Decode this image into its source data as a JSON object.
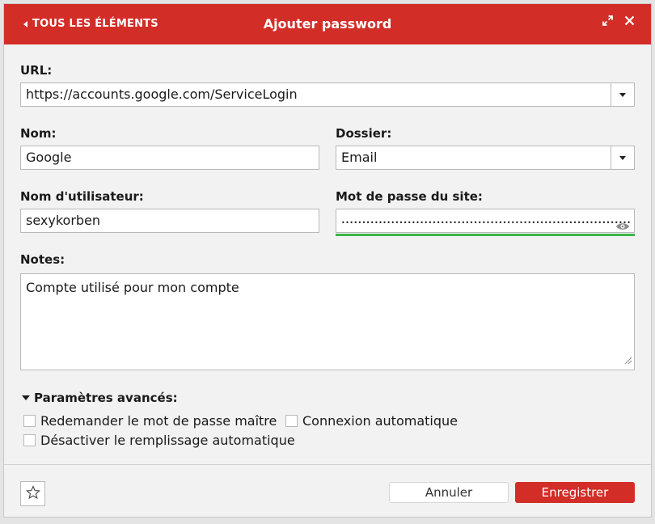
{
  "header": {
    "back_label": "TOUS LES ÉLÉMENTS",
    "title": "Ajouter password"
  },
  "form": {
    "url": {
      "label": "URL:",
      "value": "https://accounts.google.com/ServiceLogin"
    },
    "name": {
      "label": "Nom:",
      "value": "Google"
    },
    "folder": {
      "label": "Dossier:",
      "value": "Email"
    },
    "username": {
      "label": "Nom d'utilisateur:",
      "value": "sexykorben"
    },
    "password": {
      "label": "Mot de passe du site:",
      "masked_value": "••••••••••••••••••••••••••••••••••••••••••••••••••••••••••••••••••••••",
      "strength_color": "#3cb54a"
    },
    "notes": {
      "label": "Notes:",
      "value": "Compte utilisé pour mon compte"
    }
  },
  "advanced": {
    "label": "Paramètres avancés:",
    "options": [
      {
        "label": "Redemander le mot de passe maître",
        "checked": false
      },
      {
        "label": "Connexion automatique",
        "checked": false
      },
      {
        "label": "Désactiver le remplissage automatique",
        "checked": false
      }
    ]
  },
  "footer": {
    "cancel_label": "Annuler",
    "save_label": "Enregistrer"
  },
  "colors": {
    "accent": "#d32d27"
  }
}
